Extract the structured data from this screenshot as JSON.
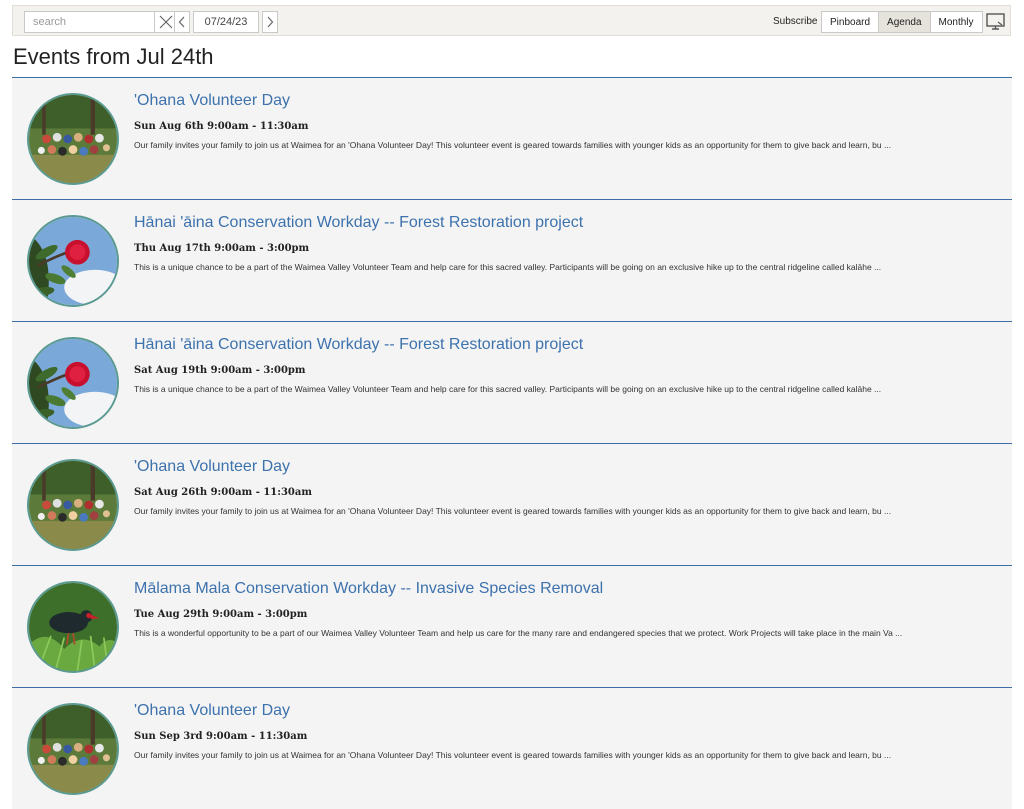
{
  "toolbar": {
    "search_placeholder": "search",
    "date": "07/24/23",
    "subscribe_label": "Subscribe",
    "views": [
      {
        "label": "Pinboard",
        "active": false
      },
      {
        "label": "Agenda",
        "active": true
      },
      {
        "label": "Monthly",
        "active": false
      }
    ],
    "icons": {
      "clear": "close-icon",
      "prev": "chevron-left-icon",
      "next": "chevron-right-icon",
      "screen": "presentation-screen-icon"
    }
  },
  "page_title": "Events from Jul 24th",
  "colors": {
    "accent": "#3d72ad",
    "divider": "#3d6fa6",
    "row_bg": "#f4f4f4",
    "toolbar_bg": "#f4f2ee"
  },
  "events": [
    {
      "title": "'Ohana Volunteer Day",
      "date": "Sun Aug 6th 9:00am - 11:30am",
      "description": "Our family invites your family to join us at Waimea for an 'Ohana Volunteer Day! This volunteer event is geared towards families with younger kids as an opportunity for them to give back and learn, bu ...",
      "image": "group-photo"
    },
    {
      "title": "Hānai 'āina Conservation Workday -- Forest Restoration project",
      "date": "Thu Aug 17th 9:00am - 3:00pm",
      "description": "This is a unique chance to be a part of the Waimea Valley Volunteer Team and help care for this sacred valley. Participants will be going on an exclusive hike up to the central ridgeline called kalāhe ...",
      "image": "lehua-flower"
    },
    {
      "title": "Hānai 'āina Conservation Workday -- Forest Restoration project",
      "date": "Sat Aug 19th 9:00am - 3:00pm",
      "description": "This is a unique chance to be a part of the Waimea Valley Volunteer Team and help care for this sacred valley. Participants will be going on an exclusive hike up to the central ridgeline called kalāhe ...",
      "image": "lehua-flower"
    },
    {
      "title": "'Ohana Volunteer Day",
      "date": "Sat Aug 26th 9:00am - 11:30am",
      "description": "Our family invites your family to join us at Waimea for an 'Ohana Volunteer Day! This volunteer event is geared towards families with younger kids as an opportunity for them to give back and learn, bu ...",
      "image": "group-photo"
    },
    {
      "title": "Mālama Mala Conservation Workday -- Invasive Species Removal",
      "date": "Tue Aug 29th 9:00am - 3:00pm",
      "description": "This is a wonderful opportunity to be a part of our Waimea Valley Volunteer Team and help us care for the many rare and endangered species that we protect. Work Projects will take place in the main Va ...",
      "image": "bird-ferns"
    },
    {
      "title": "'Ohana Volunteer Day",
      "date": "Sun Sep 3rd 9:00am - 11:30am",
      "description": "Our family invites your family to join us at Waimea for an 'Ohana Volunteer Day! This volunteer event is geared towards families with younger kids as an opportunity for them to give back and learn, bu ...",
      "image": "group-photo"
    }
  ]
}
